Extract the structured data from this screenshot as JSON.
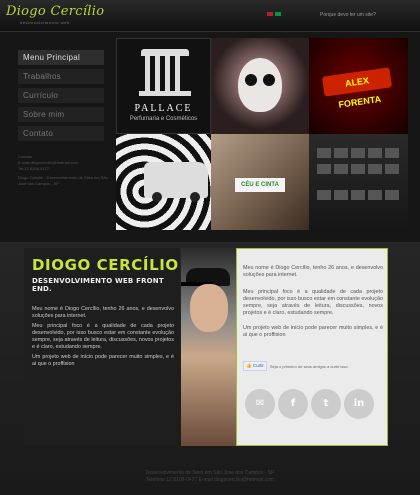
{
  "header": {
    "logo": "Diogo Cercílio",
    "logo_sub": "desenvolvimento web",
    "link": "Porque devo ter um site?",
    "flags": [
      {
        "name": "english-flag-icon",
        "color": "#b22234"
      },
      {
        "name": "brazil-flag-icon",
        "color": "#009c3b"
      }
    ]
  },
  "nav": {
    "items": [
      {
        "label": "Menu Principal",
        "active": true
      },
      {
        "label": "Trabalhos",
        "active": false
      },
      {
        "label": "Currículo",
        "active": false
      },
      {
        "label": "Sobre mim",
        "active": false
      },
      {
        "label": "Contato",
        "active": false
      }
    ]
  },
  "sidebar_contact": {
    "title": "Contato",
    "email": "E-mail:diogocercilio@hotmail.com",
    "phone": "Tel:12 8108-0477",
    "desc": "Diogo Cercílio - Desenvolvimento de Sites em São José dos Campos - SP"
  },
  "portfolio": {
    "pallace_name": "PALLACE",
    "pallace_sub": "Perfumaria e Cosméticos",
    "brand3": "ALEX FORENTA",
    "ceu": "CÉU E CINTA"
  },
  "about": {
    "name": "DIOGO CERCÍLIO",
    "subtitle": "DESENVOLVIMENTO WEB FRONT END.",
    "p1": "Meu nome é Diogo Cercílio, tenho 26 anos, e desenvolvo soluções para internet.",
    "p2": "Meu principal foco é a qualidade de cada projeto desenvolvido, por isso busco estar em constante evolução sempre, seja através de leitura, discussões, novos projetos e é claro, estudando sempre.",
    "p3": "Um projeto web de início pode parecer muito simples, e é ai que o proffision",
    "fb_button": "Curtir",
    "fb_text": "Seja o primeiro de seus amigos a curtir isso."
  },
  "social": [
    {
      "name": "email-icon",
      "glyph": "✉",
      "color": "#c7c7c7"
    },
    {
      "name": "facebook-icon",
      "glyph": "f",
      "color": "#c7c7c7"
    },
    {
      "name": "twitter-icon",
      "glyph": "t",
      "color": "#c7c7c7"
    },
    {
      "name": "linkedin-icon",
      "glyph": "in",
      "color": "#c7c7c7"
    }
  ],
  "footer": {
    "line1": "Desenvolvimento de Sites em São José dos Campos - SP",
    "line2": "Telefone 12 8108-0477 E-mail diogocercilio@hotmail.com"
  },
  "colors": {
    "accent": "#c6e63c",
    "panel": "#ebebeb"
  }
}
